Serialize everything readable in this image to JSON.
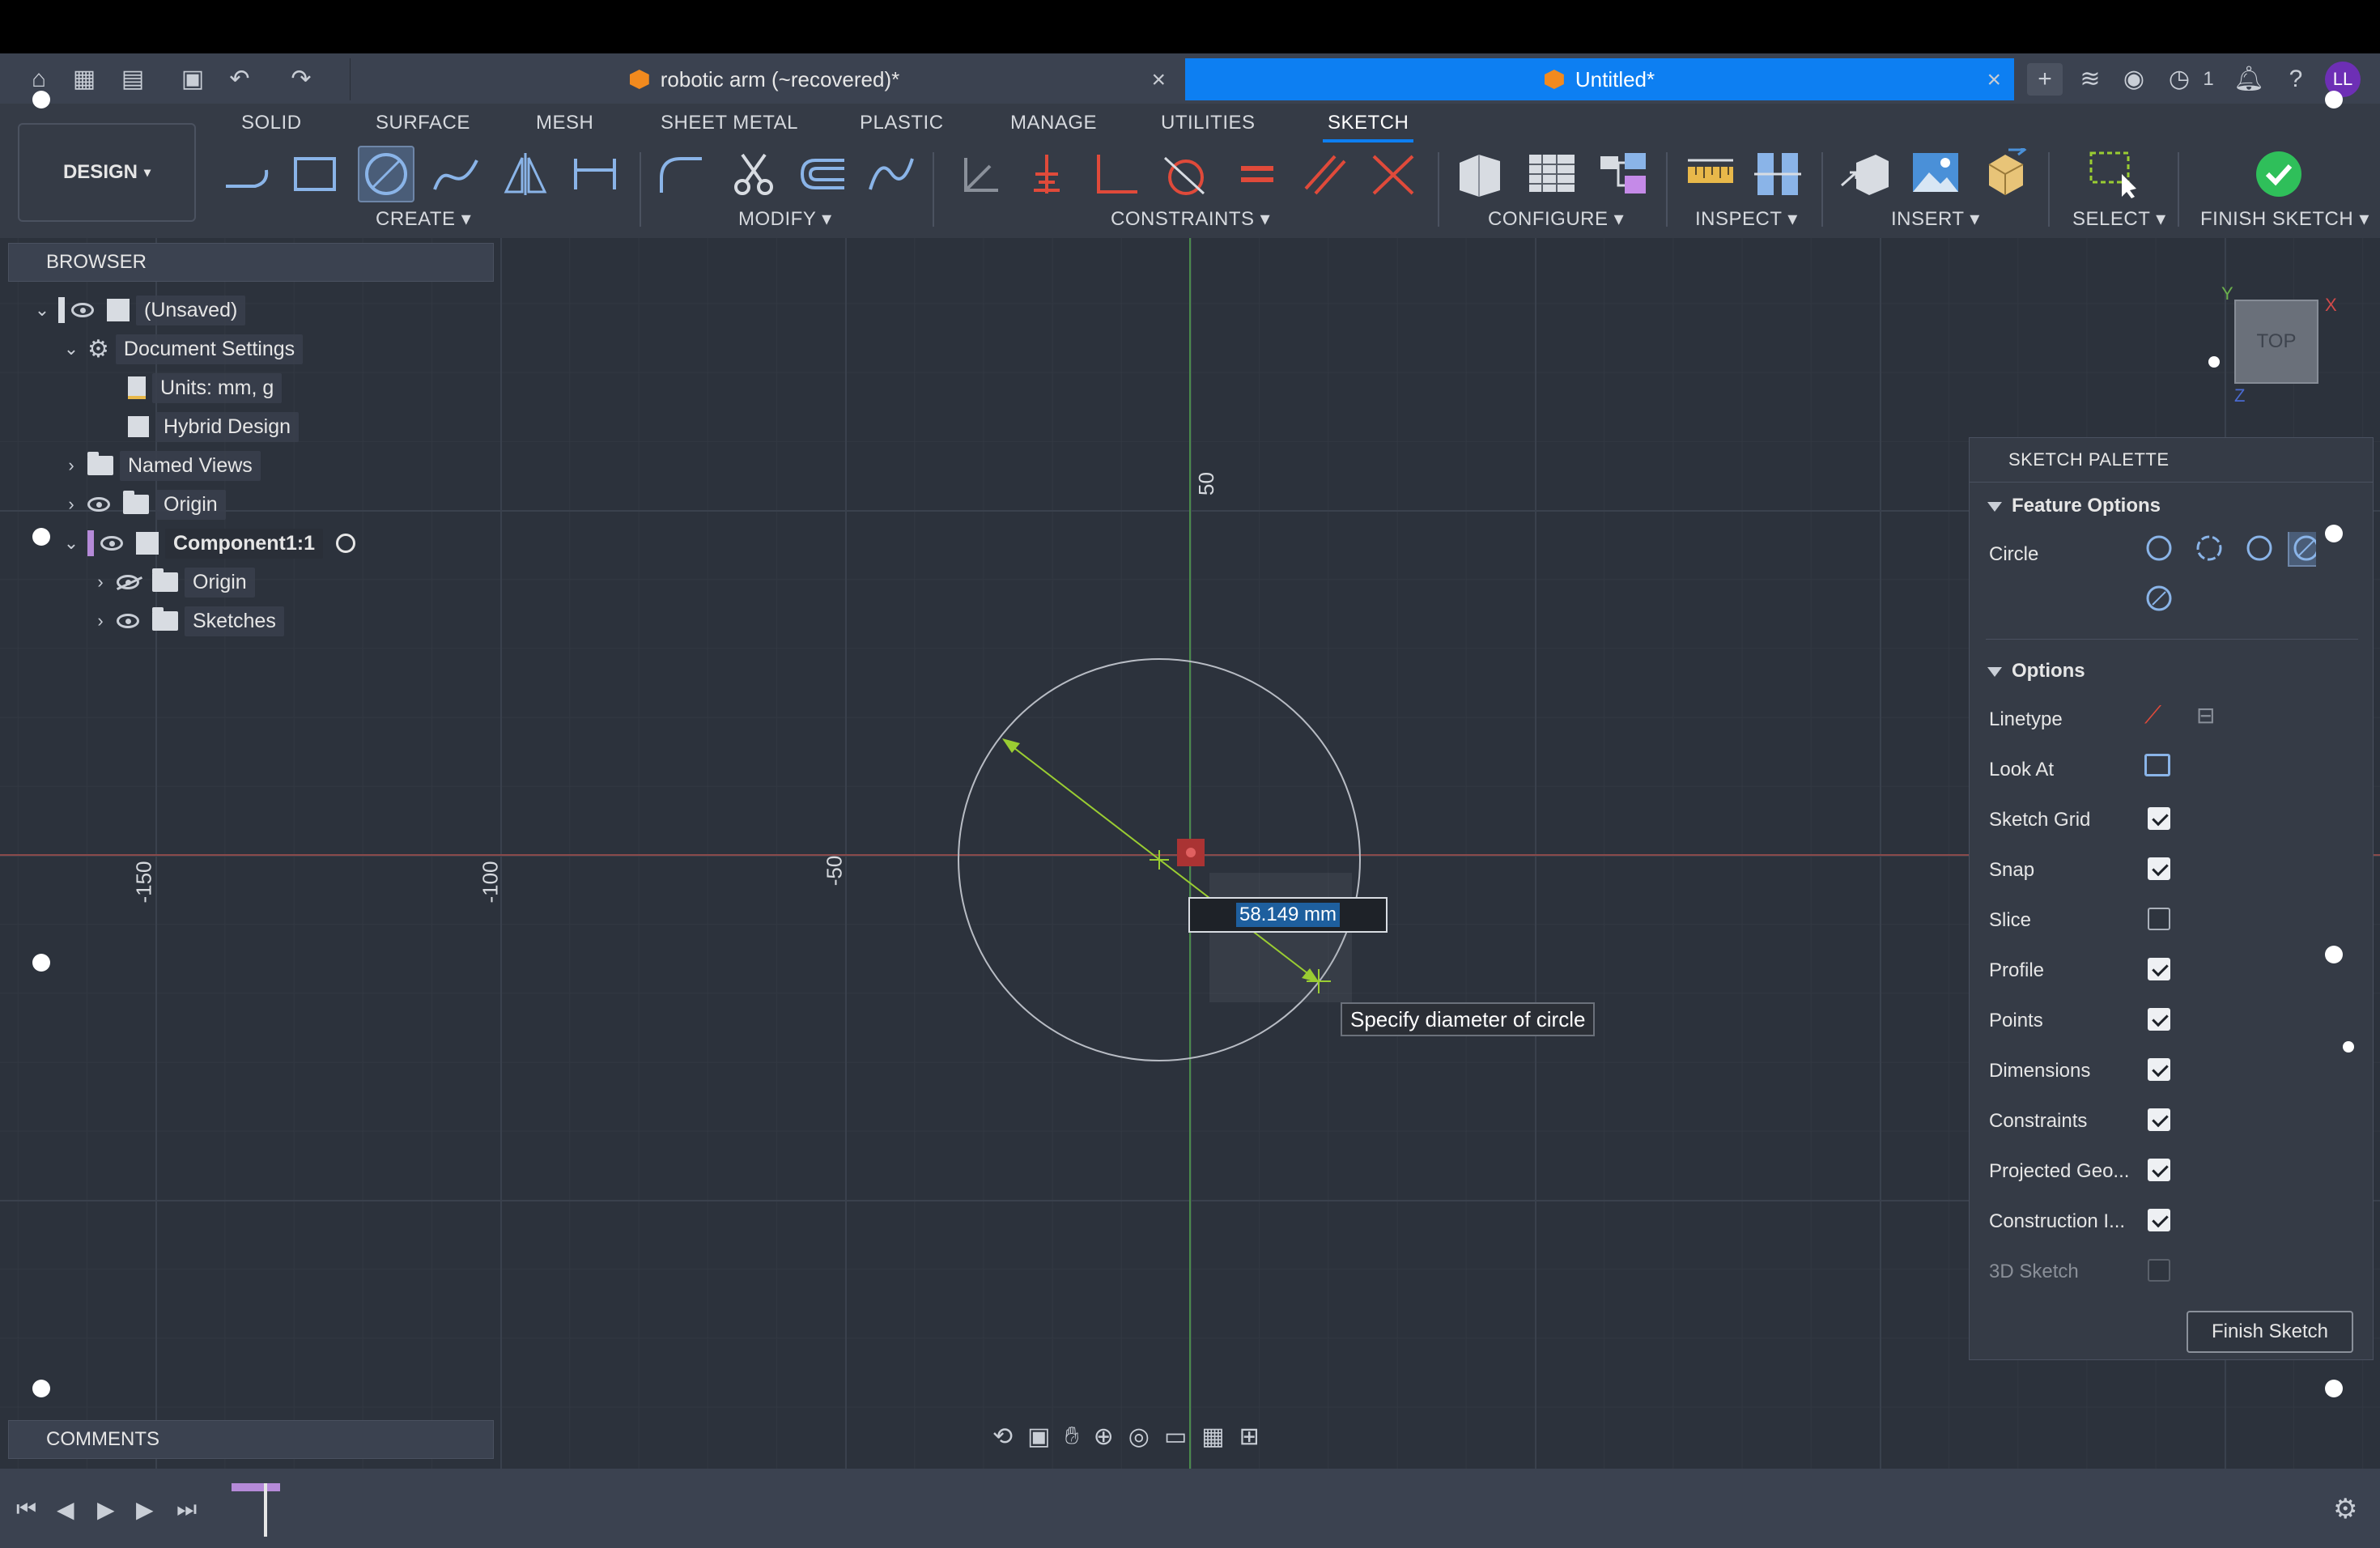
{
  "tabs": {
    "inactive_title": "robotic arm (~recovered)*",
    "active_title": "Untitled*",
    "jobs_count": "1",
    "user_initials": "LL"
  },
  "workspace_tabs": [
    "SOLID",
    "SURFACE",
    "MESH",
    "SHEET METAL",
    "PLASTIC",
    "MANAGE",
    "UTILITIES",
    "SKETCH"
  ],
  "active_workspace_tab": "SKETCH",
  "design_button": "DESIGN",
  "groups": {
    "create": "CREATE",
    "modify": "MODIFY",
    "constraints": "CONSTRAINTS",
    "configure": "CONFIGURE",
    "inspect": "INSPECT",
    "insert": "INSERT",
    "select": "SELECT",
    "finish": "FINISH SKETCH"
  },
  "browser": {
    "title": "BROWSER",
    "items": [
      {
        "label": "(Unsaved)"
      },
      {
        "label": "Document Settings"
      },
      {
        "label": "Units: mm, g"
      },
      {
        "label": "Hybrid Design"
      },
      {
        "label": "Named Views"
      },
      {
        "label": "Origin"
      },
      {
        "label": "Component1:1"
      },
      {
        "label": "Origin"
      },
      {
        "label": "Sketches"
      }
    ]
  },
  "comments_title": "COMMENTS",
  "axis_labels": {
    "y50": "50",
    "xm150": "-150",
    "xm100": "-100",
    "xm50": "-50"
  },
  "dimension_value": "58.149 mm",
  "tooltip": "Specify diameter of circle",
  "viewcube": {
    "face": "TOP",
    "x": "X",
    "y": "Y",
    "z": "Z"
  },
  "palette": {
    "title": "SKETCH PALETTE",
    "feature_options": "Feature Options",
    "circle_label": "Circle",
    "options_title": "Options",
    "rows": [
      {
        "label": "Linetype"
      },
      {
        "label": "Look At"
      },
      {
        "label": "Sketch Grid",
        "checked": true
      },
      {
        "label": "Snap",
        "checked": true
      },
      {
        "label": "Slice",
        "checked": false
      },
      {
        "label": "Profile",
        "checked": true
      },
      {
        "label": "Points",
        "checked": true
      },
      {
        "label": "Dimensions",
        "checked": true
      },
      {
        "label": "Constraints",
        "checked": true
      },
      {
        "label": "Projected Geo...",
        "checked": true
      },
      {
        "label": "Construction I...",
        "checked": true
      },
      {
        "label": "3D Sketch",
        "checked": false,
        "disabled": true
      }
    ],
    "finish_button": "Finish Sketch"
  },
  "colors": {
    "accent": "#0d7ff2",
    "viewport": "#2c323c",
    "panel": "#353b46",
    "sketch_green": "#9acd32",
    "circle": "#b8bcc4",
    "x_axis": "#8a4a4a",
    "y_axis": "#4a8a4a"
  }
}
